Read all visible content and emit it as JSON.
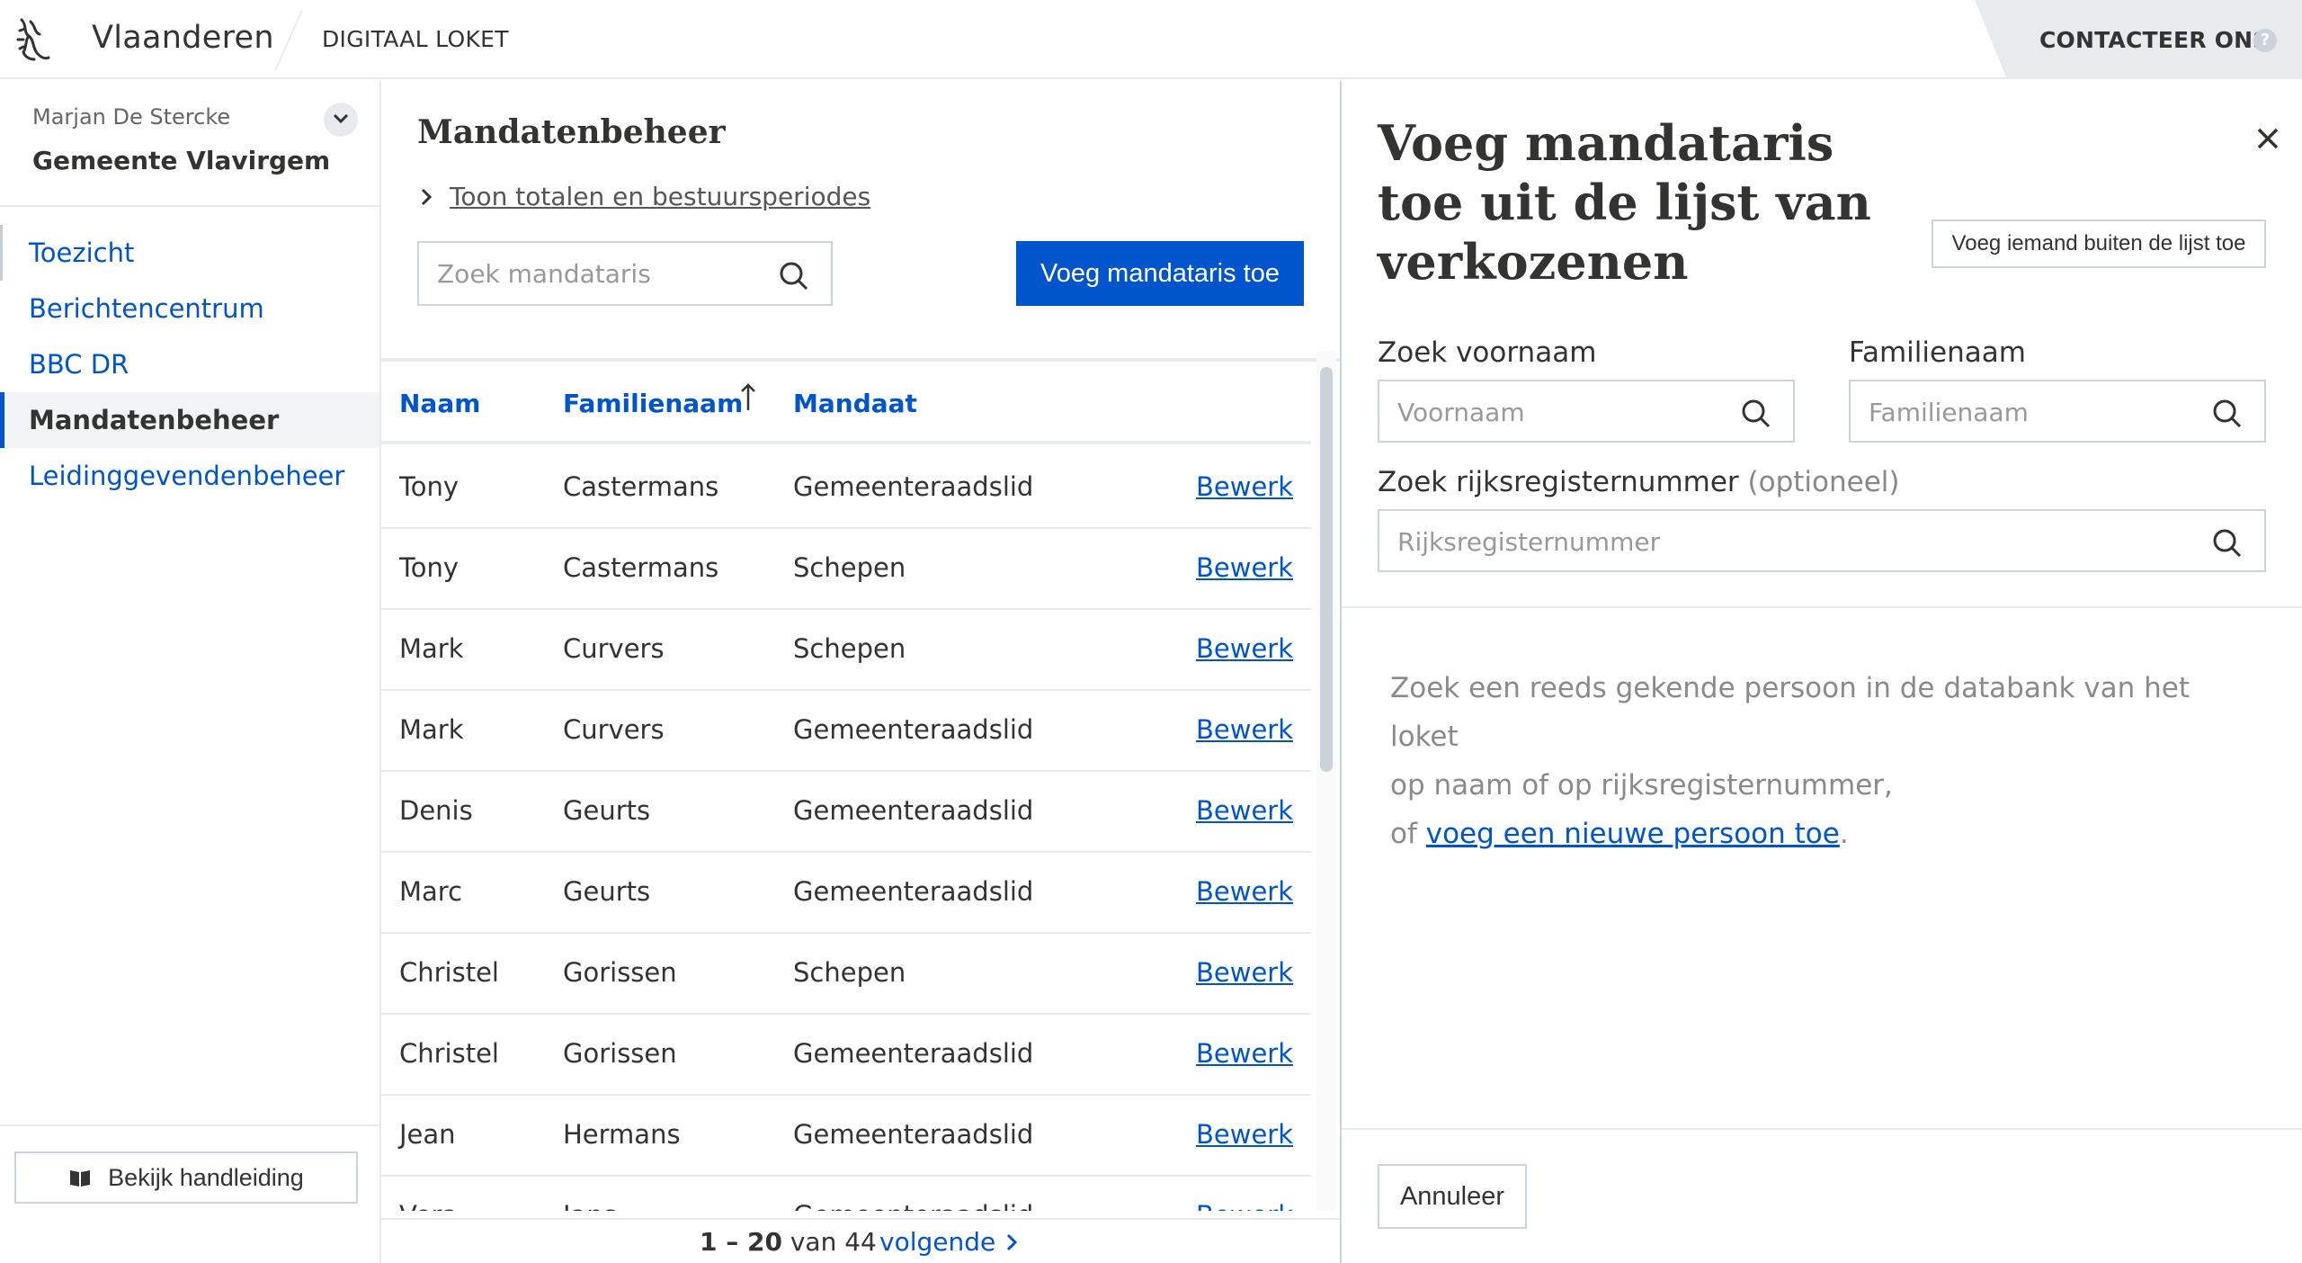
{
  "header": {
    "brand": "Vlaanderen",
    "app": "DIGITAAL LOKET",
    "contact_label": "CONTACTEER ONS",
    "help_glyph": "?"
  },
  "sidebar": {
    "user_name": "Marjan De Stercke",
    "organization": "Gemeente Vlavirgem",
    "items": [
      {
        "label": "Toezicht"
      },
      {
        "label": "Berichtencentrum"
      },
      {
        "label": "BBC DR"
      },
      {
        "label": "Mandatenbeheer",
        "active": true
      },
      {
        "label": "Leidinggevendenbeheer"
      }
    ],
    "manual_label": "Bekijk handleiding"
  },
  "main": {
    "title": "Mandatenbeheer",
    "toggle_label": "Toon totalen en bestuursperiodes",
    "search_placeholder": "Zoek mandataris",
    "add_button": "Voeg mandataris toe",
    "columns": [
      "Naam",
      "Familienaam",
      "Mandaat"
    ],
    "sort_column": "Familienaam",
    "sort_direction": "ascending",
    "edit_label": "Bewerk",
    "rows": [
      [
        "Tony",
        "Castermans",
        "Gemeenteraadslid"
      ],
      [
        "Tony",
        "Castermans",
        "Schepen"
      ],
      [
        "Mark",
        "Curvers",
        "Schepen"
      ],
      [
        "Mark",
        "Curvers",
        "Gemeenteraadslid"
      ],
      [
        "Denis",
        "Geurts",
        "Gemeenteraadslid"
      ],
      [
        "Marc",
        "Geurts",
        "Gemeenteraadslid"
      ],
      [
        "Christel",
        "Gorissen",
        "Schepen"
      ],
      [
        "Christel",
        "Gorissen",
        "Gemeenteraadslid"
      ],
      [
        "Jean",
        "Hermans",
        "Gemeenteraadslid"
      ],
      [
        "Vera",
        "Jans",
        "Gemeenteraadslid"
      ]
    ],
    "pagination": {
      "range": "1 – 20",
      "of_label": "van 44",
      "next_label": "volgende"
    }
  },
  "panel": {
    "title": "Voeg mandataris toe uit de lijst van verkozenen",
    "outside_button": "Voeg iemand buiten de lijst toe",
    "first_name_label": "Zoek voornaam",
    "first_name_placeholder": "Voornaam",
    "last_name_label": "Familienaam",
    "last_name_placeholder": "Familienaam",
    "rrn_label": "Zoek rijksregisternummer",
    "rrn_optional": "(optioneel)",
    "rrn_placeholder": "Rijksregisternummer",
    "hint_line1": "Zoek een reeds gekende persoon in de databank van het loket",
    "hint_line2": "op naam of op rijksregisternummer,",
    "hint_prefix": "of ",
    "hint_link": "voeg een nieuwe persoon toe",
    "hint_suffix": ".",
    "cancel_button": "Annuleer"
  },
  "colors": {
    "accent": "#0055cc",
    "border": "#cbd2da",
    "divider": "#e8ebee",
    "text": "#333332"
  },
  "icons": [
    "flemish-lion-icon",
    "help-icon",
    "chevron-down-icon",
    "chevron-right-icon",
    "search-icon",
    "sort-arrow-up-icon",
    "book-icon",
    "close-icon"
  ]
}
